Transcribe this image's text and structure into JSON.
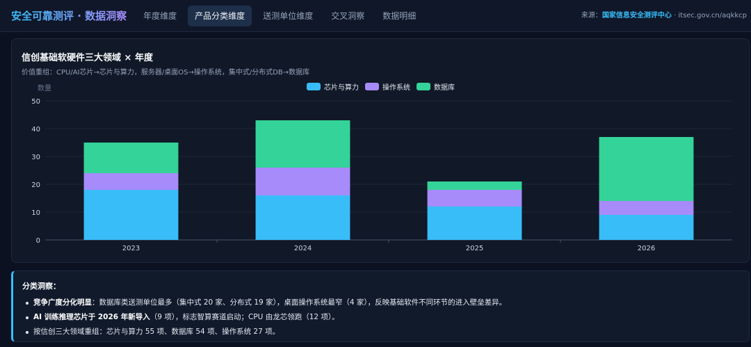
{
  "header": {
    "title": "安全可靠测评 · 数据洞察",
    "tabs": [
      {
        "label": "年度维度",
        "active": false
      },
      {
        "label": "产品分类维度",
        "active": true
      },
      {
        "label": "送测单位维度",
        "active": false
      },
      {
        "label": "交叉洞察",
        "active": false
      },
      {
        "label": "数据明细",
        "active": false
      }
    ],
    "source_prefix": "来源：",
    "source_org": "国家信息安全测评中心",
    "source_suffix": " · itsec.gov.cn/aqkkcp"
  },
  "card": {
    "title": "信创基础软硬件三大领域 × 年度",
    "subtitle": "价值重组：CPU/AI芯片→芯片与算力，服务器/桌面OS→操作系统，集中式/分布式DB→数据库"
  },
  "chart_data": {
    "type": "bar",
    "stacked": true,
    "categories": [
      "2023",
      "2024",
      "2025",
      "2026"
    ],
    "series": [
      {
        "name": "芯片与算力",
        "values": [
          18,
          16,
          12,
          9
        ],
        "color": "#38bdf8"
      },
      {
        "name": "操作系统",
        "values": [
          6,
          10,
          6,
          5
        ],
        "color": "#a78bfa"
      },
      {
        "name": "数据库",
        "values": [
          11,
          17,
          3,
          23
        ],
        "color": "#34d399"
      }
    ],
    "ylabel": "数量",
    "ylim": [
      0,
      50
    ],
    "yticks": [
      0,
      10,
      20,
      30,
      40,
      50
    ],
    "grid": true,
    "legend": "top-center"
  },
  "insight": {
    "title": "分类洞察：",
    "items": [
      {
        "bold": "竞争广度分化明显",
        "text": "：数据库类送测单位最多（集中式 20 家、分布式 19 家），桌面操作系统最窄（4 家），反映基础软件不同环节的进入壁垒差异。"
      },
      {
        "bold": "AI 训练推理芯片于 2026 年新导入",
        "text": "（9 项），标志智算赛道启动；CPU 由龙芯领跑（12 项）。"
      },
      {
        "bold": "",
        "text": "按信创三大领域重组：芯片与算力 55 项、数据库 54 项、操作系统 27 项。"
      }
    ]
  }
}
